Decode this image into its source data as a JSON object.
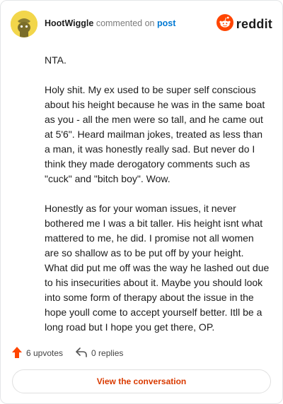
{
  "header": {
    "username": "HootWiggle",
    "action_text": "commented on",
    "target_link": "post",
    "brand": "reddit",
    "avatar_icon": "snoo-avatar-icon",
    "brand_icon": "reddit-logo-icon"
  },
  "comment": {
    "paragraphs": [
      "NTA.",
      "Holy shit. My ex used to be super self conscious about his height because he was in the same boat as you - all the men were so tall, and he came out at 5'6\". Heard mailman jokes, treated as less than a man, it was honestly really sad. But never do I think they made derogatory comments such as \"cuck\" and \"bitch boy\". Wow.",
      "Honestly as for your woman issues, it never bothered me I was a bit taller. His height isnt what mattered to me, he did. I promise not all women are so shallow as to be put off by your height. What did put me off was the way he lashed out due to his insecurities about it. Maybe you should look into some form of therapy about the issue in the hope youll come to accept yourself better. Itll be a long road but I hope you get there, OP."
    ]
  },
  "footer": {
    "upvotes": "6 upvotes",
    "replies": "0 replies",
    "upvote_icon": "upvote-arrow-icon",
    "reply_icon": "reply-arrow-icon",
    "view_conversation": "View the conversation"
  },
  "colors": {
    "brand_orange": "#ff4500",
    "link_blue": "#0079d3",
    "cta_text": "#d93a00",
    "avatar_bg": "#f2d64b"
  }
}
